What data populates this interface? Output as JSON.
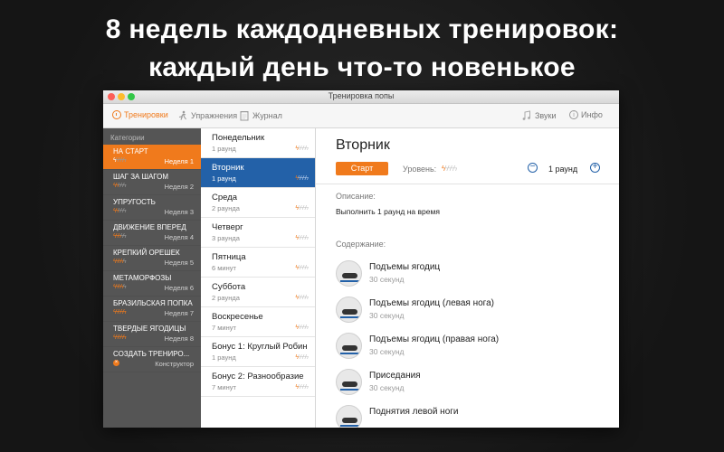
{
  "headline": {
    "line1": "8 недель каждодневных тренировок:",
    "line2": "каждый день что-то новенькое"
  },
  "window": {
    "title": "Тренировка попы"
  },
  "toolbar": {
    "workouts": "Тренировки",
    "exercises": "Упражнения",
    "journal": "Журнал",
    "sounds": "Звуки",
    "info": "Инфо",
    "info_glyph": "i"
  },
  "sidebar": {
    "header": "Категории",
    "items": [
      {
        "title": "НА СТАРТ",
        "week": "Неделя 1",
        "level": 1
      },
      {
        "title": "ШАГ ЗА ШАГОМ",
        "week": "Неделя 2",
        "level": 2
      },
      {
        "title": "УПРУГОСТЬ",
        "week": "Неделя 3",
        "level": 2
      },
      {
        "title": "ДВИЖЕНИЕ ВПЕРЕД",
        "week": "Неделя 4",
        "level": 3
      },
      {
        "title": "КРЕПКИЙ ОРЕШЕК",
        "week": "Неделя 5",
        "level": 4
      },
      {
        "title": "МЕТАМОРФОЗЫ",
        "week": "Неделя 6",
        "level": 4
      },
      {
        "title": "БРАЗИЛЬСКАЯ ПОПКА",
        "week": "Неделя 7",
        "level": 5
      },
      {
        "title": "ТВЕРДЫЕ ЯГОДИЦЫ",
        "week": "Неделя 8",
        "level": 5
      },
      {
        "title": "СОЗДАТЬ ТРЕНИРО...",
        "week": "Конструктор"
      }
    ]
  },
  "days": [
    {
      "name": "Понедельник",
      "sub": "1 раунд",
      "level": 1
    },
    {
      "name": "Вторник",
      "sub": "1 раунд",
      "level": 1
    },
    {
      "name": "Среда",
      "sub": "2 раунда",
      "level": 1
    },
    {
      "name": "Четверг",
      "sub": "3 раунда",
      "level": 1
    },
    {
      "name": "Пятница",
      "sub": "6 минут",
      "level": 1
    },
    {
      "name": "Суббота",
      "sub": "2 раунда",
      "level": 1
    },
    {
      "name": "Воскресенье",
      "sub": "7 минут",
      "level": 1
    },
    {
      "name": "Бонус 1: Круглый Робин",
      "sub": "1 раунд",
      "level": 1
    },
    {
      "name": "Бонус 2: Разнообразие",
      "sub": "7 минут",
      "level": 1
    }
  ],
  "detail": {
    "title": "Вторник",
    "start_label": "Старт",
    "level_label": "Уровень:",
    "level": 1,
    "rounds": "1 раунд",
    "minus": "−",
    "plus": "+",
    "description_label": "Описание:",
    "description": "Выполнить 1 раунд на время",
    "content_label": "Содержание:",
    "exercises": [
      {
        "name": "Подъемы ягодиц",
        "duration": "30 секунд"
      },
      {
        "name": "Подъемы ягодиц (левая нога)",
        "duration": "30 секунд"
      },
      {
        "name": "Подъемы ягодиц (правая нога)",
        "duration": "30 секунд"
      },
      {
        "name": "Приседания",
        "duration": "30 секунд"
      },
      {
        "name": "Поднятия левой ноги",
        "duration": ""
      }
    ]
  },
  "colors": {
    "accent": "#f07a1c",
    "selection": "#2361a8",
    "sidebar": "#555555"
  },
  "icons": {
    "bolt": "⚡",
    "bolt_char": "ϟ"
  }
}
